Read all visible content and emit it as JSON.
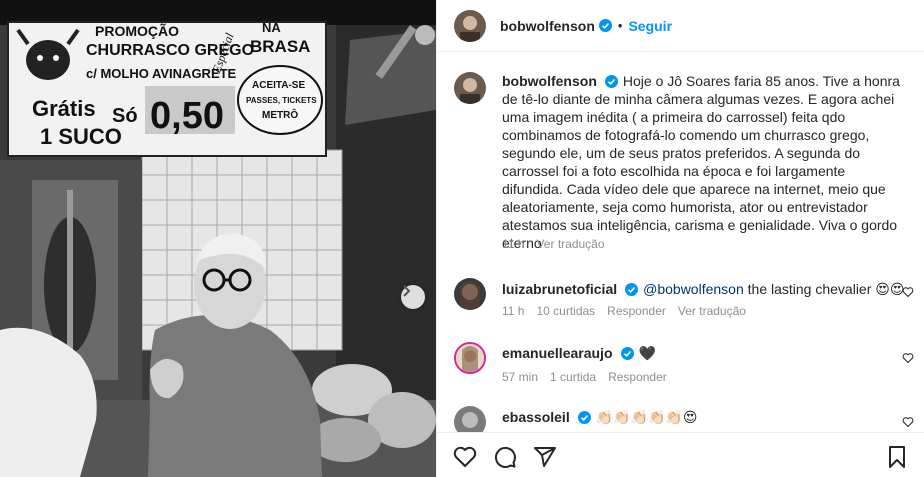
{
  "post": {
    "author": "bobwolfenson",
    "follow_label": "Seguir",
    "separator": "•"
  },
  "caption": {
    "author": "bobwolfenson",
    "text": "Hoje o Jô Soares faria 85 anos. Tive a honra de tê-lo diante de minha câmera algumas vezes. E agora achei uma imagem inédita ( a primeira do carrossel) feita qdo combinamos de fotografá-lo comendo um churrasco grego, segundo ele, um de seus pratos preferidos. A segunda do carrossel foi a foto escolhida na época e foi largamente difundida. Cada vídeo dele que aparece na internet, meio que aleatoriamente, seja como humorista, ator ou entrevistador atestamos sua inteligência, carisma e genialidade. Viva o gordo eterno",
    "time": "11 h",
    "translate": "Ver tradução"
  },
  "comments": [
    {
      "author": "luizabrunetoficial",
      "mention": "@bobwolfenson",
      "text": " the lasting chevalier 😍😍",
      "time": "11 h",
      "likes": "10 curtidas",
      "reply": "Responder",
      "translate": "Ver tradução"
    },
    {
      "author": "emanuellearaujo",
      "text": "🖤",
      "time": "57 min",
      "likes": "1 curtida",
      "reply": "Responder"
    },
    {
      "author": "ebassoleil",
      "text": "👏🏻👏🏻👏🏻👏🏻👏🏻😍"
    }
  ],
  "sign": {
    "line1": "PROMOÇÃO",
    "line2": "CHURRASCO GREGO",
    "line3": "c/ MOLHO AVINAGRETE",
    "especial": "Especial",
    "brasa1": "NA",
    "brasa2": "BRASA",
    "gratis": "Grátis",
    "suco": "1 SUCO",
    "so": "Só",
    "price": "0,50",
    "aceita": "ACEITA-SE",
    "passes": "PASSES, TICKETS",
    "metro": "METRÔ"
  },
  "colors": {
    "link": "#0095f6",
    "text": "#262626",
    "muted": "#8e8e8e",
    "verified": "#0095f6",
    "border": "#efefef"
  },
  "icons": [
    "verified-badge-icon",
    "heart-icon",
    "comment-icon",
    "share-icon",
    "save-icon",
    "chevron-right-icon"
  ]
}
